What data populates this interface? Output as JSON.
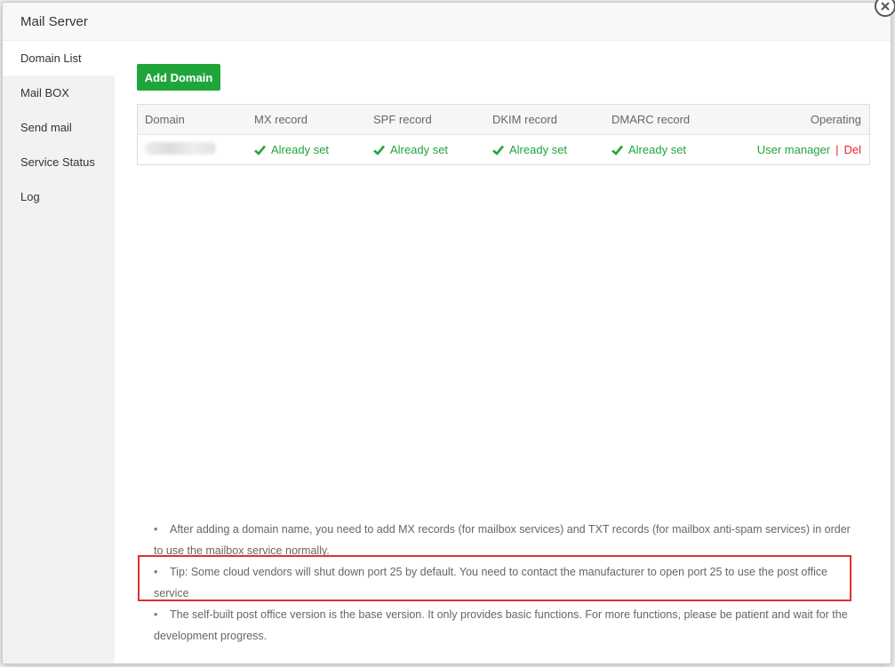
{
  "window": {
    "title": "Mail Server"
  },
  "sidebar": {
    "items": [
      {
        "label": "Domain List"
      },
      {
        "label": "Mail BOX"
      },
      {
        "label": "Send mail"
      },
      {
        "label": "Service Status"
      },
      {
        "label": "Log"
      }
    ]
  },
  "toolbar": {
    "add_domain_label": "Add Domain"
  },
  "table": {
    "headers": [
      "Domain",
      "MX record",
      "SPF record",
      "DKIM record",
      "DMARC record",
      "Operating"
    ],
    "rows": [
      {
        "domain": "",
        "mx": "Already set",
        "spf": "Already set",
        "dkim": "Already set",
        "dmarc": "Already set",
        "user_manager": "User manager",
        "separator": "|",
        "del": "Del"
      }
    ]
  },
  "notes": [
    "After adding a domain name, you need to add MX records (for mailbox services) and TXT records (for mailbox anti-spam services) in order to use the mailbox service normally.",
    "Tip: Some cloud vendors will shut down port 25 by default. You need to contact the manufacturer to open port 25 to use the post office service",
    "The self-built post office version is the base version. It only provides basic functions. For more functions, please be patient and wait for the development progress."
  ],
  "colors": {
    "accent": "#20a53a",
    "danger": "#e22222",
    "highlight": "#e03030"
  },
  "icons": {
    "close": "close-icon",
    "check": "check-icon"
  }
}
